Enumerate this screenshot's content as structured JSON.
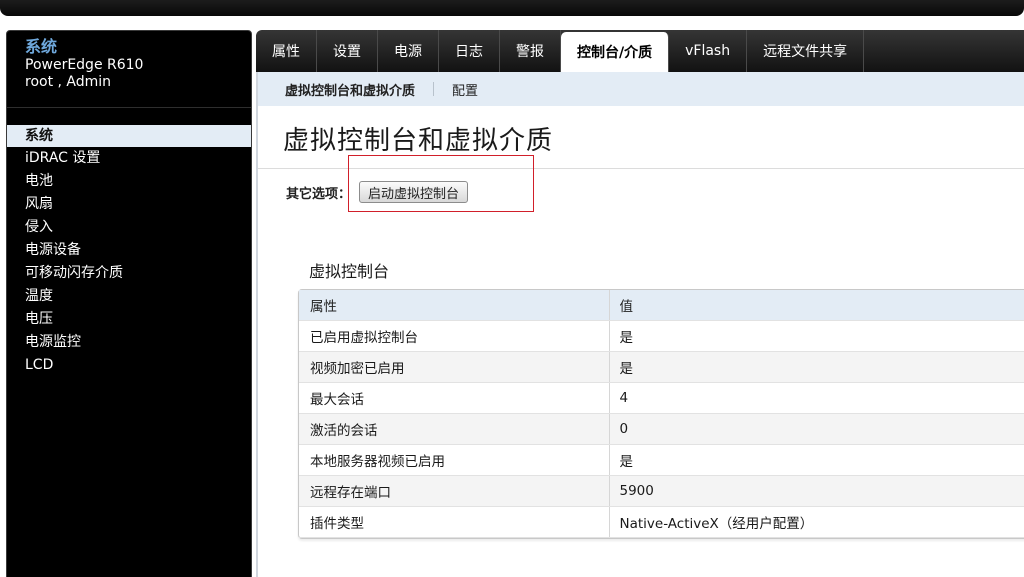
{
  "sidebar": {
    "brand": "系统",
    "model": "PowerEdge R610",
    "user": "root , Admin",
    "items": [
      {
        "label": "系统"
      },
      {
        "label": "iDRAC 设置"
      },
      {
        "label": "电池"
      },
      {
        "label": "风扇"
      },
      {
        "label": "侵入"
      },
      {
        "label": "电源设备"
      },
      {
        "label": "可移动闪存介质"
      },
      {
        "label": "温度"
      },
      {
        "label": "电压"
      },
      {
        "label": "电源监控"
      },
      {
        "label": "LCD"
      }
    ]
  },
  "tabs": [
    {
      "label": "属性"
    },
    {
      "label": "设置"
    },
    {
      "label": "电源"
    },
    {
      "label": "日志"
    },
    {
      "label": "警报"
    },
    {
      "label": "控制台/介质"
    },
    {
      "label": "vFlash"
    },
    {
      "label": "远程文件共享"
    }
  ],
  "subtabs": [
    {
      "label": "虚拟控制台和虚拟介质"
    },
    {
      "label": "配置"
    }
  ],
  "page": {
    "title": "虚拟控制台和虚拟介质",
    "options_label": "其它选项：",
    "launch_button": "启动虚拟控制台",
    "section_title": "虚拟控制台"
  },
  "table": {
    "headers": [
      "属性",
      "值"
    ],
    "rows": [
      [
        "已启用虚拟控制台",
        "是"
      ],
      [
        "视频加密已启用",
        "是"
      ],
      [
        "最大会话",
        "4"
      ],
      [
        "激活的会话",
        "0"
      ],
      [
        "本地服务器视频已启用",
        "是"
      ],
      [
        "远程存在端口",
        "5900"
      ],
      [
        "插件类型",
        "Native-ActiveX（经用户配置）"
      ]
    ]
  },
  "colors": {
    "accent_blue": "#6fa8dc",
    "subnav_bg": "#e3ecf5",
    "highlight_red": "#d11f2a"
  }
}
